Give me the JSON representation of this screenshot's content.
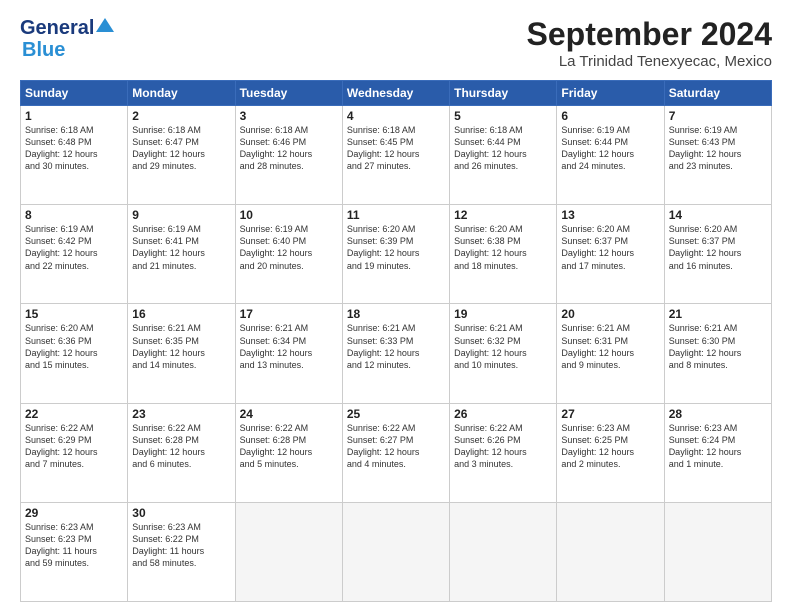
{
  "header": {
    "logo_general": "General",
    "logo_blue": "Blue",
    "title": "September 2024",
    "subtitle": "La Trinidad Tenexyecac, Mexico"
  },
  "weekdays": [
    "Sunday",
    "Monday",
    "Tuesday",
    "Wednesday",
    "Thursday",
    "Friday",
    "Saturday"
  ],
  "weeks": [
    [
      {
        "day": "1",
        "lines": [
          "Sunrise: 6:18 AM",
          "Sunset: 6:48 PM",
          "Daylight: 12 hours",
          "and 30 minutes."
        ]
      },
      {
        "day": "2",
        "lines": [
          "Sunrise: 6:18 AM",
          "Sunset: 6:47 PM",
          "Daylight: 12 hours",
          "and 29 minutes."
        ]
      },
      {
        "day": "3",
        "lines": [
          "Sunrise: 6:18 AM",
          "Sunset: 6:46 PM",
          "Daylight: 12 hours",
          "and 28 minutes."
        ]
      },
      {
        "day": "4",
        "lines": [
          "Sunrise: 6:18 AM",
          "Sunset: 6:45 PM",
          "Daylight: 12 hours",
          "and 27 minutes."
        ]
      },
      {
        "day": "5",
        "lines": [
          "Sunrise: 6:18 AM",
          "Sunset: 6:44 PM",
          "Daylight: 12 hours",
          "and 26 minutes."
        ]
      },
      {
        "day": "6",
        "lines": [
          "Sunrise: 6:19 AM",
          "Sunset: 6:44 PM",
          "Daylight: 12 hours",
          "and 24 minutes."
        ]
      },
      {
        "day": "7",
        "lines": [
          "Sunrise: 6:19 AM",
          "Sunset: 6:43 PM",
          "Daylight: 12 hours",
          "and 23 minutes."
        ]
      }
    ],
    [
      {
        "day": "8",
        "lines": [
          "Sunrise: 6:19 AM",
          "Sunset: 6:42 PM",
          "Daylight: 12 hours",
          "and 22 minutes."
        ]
      },
      {
        "day": "9",
        "lines": [
          "Sunrise: 6:19 AM",
          "Sunset: 6:41 PM",
          "Daylight: 12 hours",
          "and 21 minutes."
        ]
      },
      {
        "day": "10",
        "lines": [
          "Sunrise: 6:19 AM",
          "Sunset: 6:40 PM",
          "Daylight: 12 hours",
          "and 20 minutes."
        ]
      },
      {
        "day": "11",
        "lines": [
          "Sunrise: 6:20 AM",
          "Sunset: 6:39 PM",
          "Daylight: 12 hours",
          "and 19 minutes."
        ]
      },
      {
        "day": "12",
        "lines": [
          "Sunrise: 6:20 AM",
          "Sunset: 6:38 PM",
          "Daylight: 12 hours",
          "and 18 minutes."
        ]
      },
      {
        "day": "13",
        "lines": [
          "Sunrise: 6:20 AM",
          "Sunset: 6:37 PM",
          "Daylight: 12 hours",
          "and 17 minutes."
        ]
      },
      {
        "day": "14",
        "lines": [
          "Sunrise: 6:20 AM",
          "Sunset: 6:37 PM",
          "Daylight: 12 hours",
          "and 16 minutes."
        ]
      }
    ],
    [
      {
        "day": "15",
        "lines": [
          "Sunrise: 6:20 AM",
          "Sunset: 6:36 PM",
          "Daylight: 12 hours",
          "and 15 minutes."
        ]
      },
      {
        "day": "16",
        "lines": [
          "Sunrise: 6:21 AM",
          "Sunset: 6:35 PM",
          "Daylight: 12 hours",
          "and 14 minutes."
        ]
      },
      {
        "day": "17",
        "lines": [
          "Sunrise: 6:21 AM",
          "Sunset: 6:34 PM",
          "Daylight: 12 hours",
          "and 13 minutes."
        ]
      },
      {
        "day": "18",
        "lines": [
          "Sunrise: 6:21 AM",
          "Sunset: 6:33 PM",
          "Daylight: 12 hours",
          "and 12 minutes."
        ]
      },
      {
        "day": "19",
        "lines": [
          "Sunrise: 6:21 AM",
          "Sunset: 6:32 PM",
          "Daylight: 12 hours",
          "and 10 minutes."
        ]
      },
      {
        "day": "20",
        "lines": [
          "Sunrise: 6:21 AM",
          "Sunset: 6:31 PM",
          "Daylight: 12 hours",
          "and 9 minutes."
        ]
      },
      {
        "day": "21",
        "lines": [
          "Sunrise: 6:21 AM",
          "Sunset: 6:30 PM",
          "Daylight: 12 hours",
          "and 8 minutes."
        ]
      }
    ],
    [
      {
        "day": "22",
        "lines": [
          "Sunrise: 6:22 AM",
          "Sunset: 6:29 PM",
          "Daylight: 12 hours",
          "and 7 minutes."
        ]
      },
      {
        "day": "23",
        "lines": [
          "Sunrise: 6:22 AM",
          "Sunset: 6:28 PM",
          "Daylight: 12 hours",
          "and 6 minutes."
        ]
      },
      {
        "day": "24",
        "lines": [
          "Sunrise: 6:22 AM",
          "Sunset: 6:28 PM",
          "Daylight: 12 hours",
          "and 5 minutes."
        ]
      },
      {
        "day": "25",
        "lines": [
          "Sunrise: 6:22 AM",
          "Sunset: 6:27 PM",
          "Daylight: 12 hours",
          "and 4 minutes."
        ]
      },
      {
        "day": "26",
        "lines": [
          "Sunrise: 6:22 AM",
          "Sunset: 6:26 PM",
          "Daylight: 12 hours",
          "and 3 minutes."
        ]
      },
      {
        "day": "27",
        "lines": [
          "Sunrise: 6:23 AM",
          "Sunset: 6:25 PM",
          "Daylight: 12 hours",
          "and 2 minutes."
        ]
      },
      {
        "day": "28",
        "lines": [
          "Sunrise: 6:23 AM",
          "Sunset: 6:24 PM",
          "Daylight: 12 hours",
          "and 1 minute."
        ]
      }
    ],
    [
      {
        "day": "29",
        "lines": [
          "Sunrise: 6:23 AM",
          "Sunset: 6:23 PM",
          "Daylight: 11 hours",
          "and 59 minutes."
        ]
      },
      {
        "day": "30",
        "lines": [
          "Sunrise: 6:23 AM",
          "Sunset: 6:22 PM",
          "Daylight: 11 hours",
          "and 58 minutes."
        ]
      },
      {
        "day": "",
        "lines": []
      },
      {
        "day": "",
        "lines": []
      },
      {
        "day": "",
        "lines": []
      },
      {
        "day": "",
        "lines": []
      },
      {
        "day": "",
        "lines": []
      }
    ]
  ]
}
